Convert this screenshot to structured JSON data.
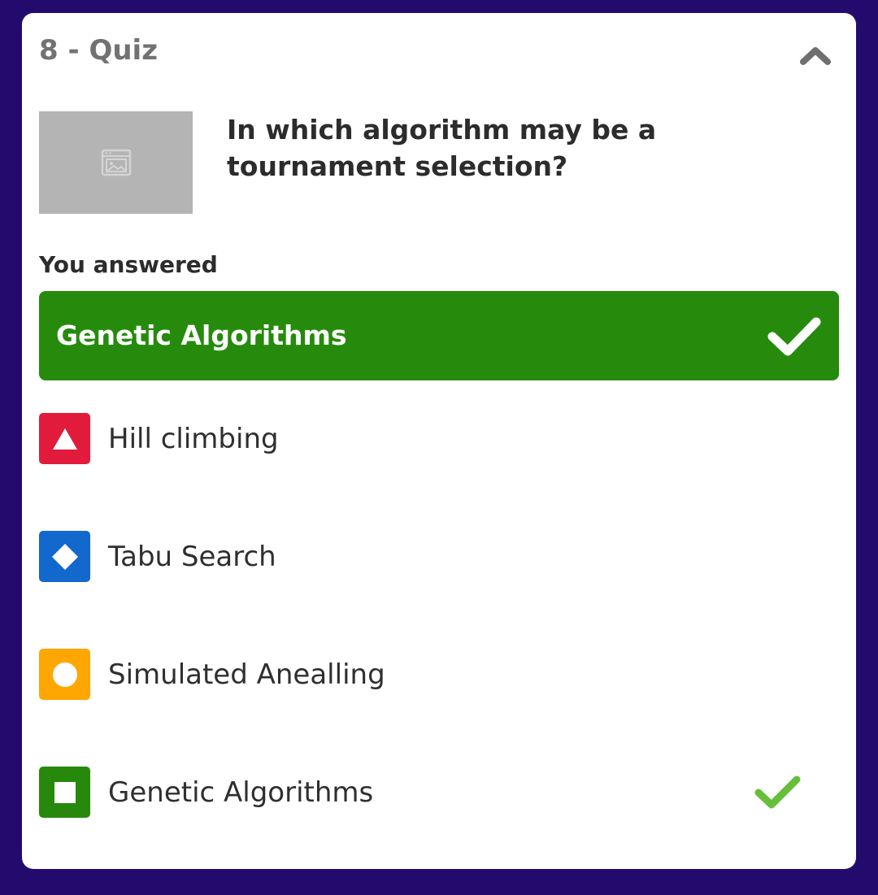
{
  "card": {
    "title": "8 - Quiz",
    "collapse_icon": "chevron-up-icon",
    "image_icon": "image-placeholder-icon"
  },
  "question": {
    "text": "In which algorithm may be a tournament selection?"
  },
  "response": {
    "heading": "You answered",
    "answer_text": "Genetic Algorithms",
    "status": "correct",
    "status_icon": "checkmark-icon",
    "color": "#268b0c"
  },
  "options": [
    {
      "label": "Hill climbing",
      "shape": "triangle",
      "color": "#e21b3c",
      "correct": false
    },
    {
      "label": "Tabu Search",
      "shape": "diamond",
      "color": "#1368ce",
      "correct": false
    },
    {
      "label": "Simulated Anealling",
      "shape": "circle",
      "color": "#ffa602",
      "correct": false
    },
    {
      "label": "Genetic Algorithms",
      "shape": "square",
      "color": "#26890c",
      "correct": true
    }
  ],
  "colors": {
    "background": "#230b6e",
    "card": "#ffffff",
    "correct_check": "#66bf39"
  }
}
